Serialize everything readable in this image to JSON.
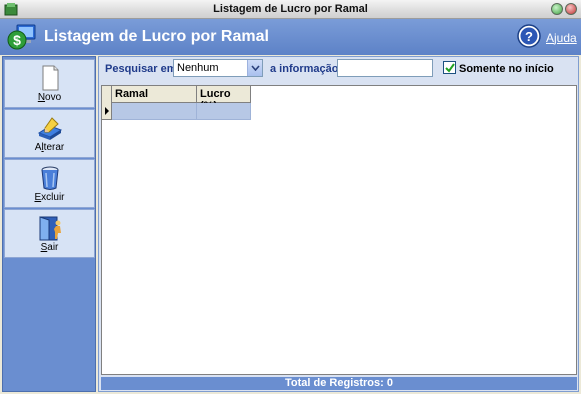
{
  "window": {
    "title": "Listagem de Lucro por Ramal"
  },
  "header": {
    "title": "Listagem de Lucro por Ramal",
    "help_label": "Ajuda",
    "help_mnemonic": "A",
    "help_rest": "juda"
  },
  "sidebar": {
    "items": [
      {
        "label": "Novo",
        "mnemonic": "N",
        "rest": "ovo",
        "icon": "new-document-icon"
      },
      {
        "label": "Alterar",
        "before": "A",
        "mnemonic": "l",
        "rest": "terar",
        "icon": "edit-icon"
      },
      {
        "label": "Excluir",
        "mnemonic": "E",
        "rest": "xcluir",
        "icon": "trash-icon"
      },
      {
        "label": "Sair",
        "mnemonic": "S",
        "rest": "air",
        "icon": "exit-door-icon"
      }
    ]
  },
  "search": {
    "field_label": "Pesquisar em",
    "field_value": "Nenhum",
    "info_label": "a informação",
    "info_value": "",
    "only_start_label": "Somente no início",
    "only_start_checked": true
  },
  "grid": {
    "columns": [
      "Ramal",
      "Lucro (%)"
    ],
    "rows": [
      [
        "",
        ""
      ]
    ]
  },
  "footer": {
    "total_text": "Total de Registros: 0"
  },
  "colors": {
    "header_bg": "#6b8fd0",
    "sidebar_bg": "#6a8ed0",
    "button_bg": "#d7e3f5",
    "selected_row": "#b7c8e6"
  }
}
